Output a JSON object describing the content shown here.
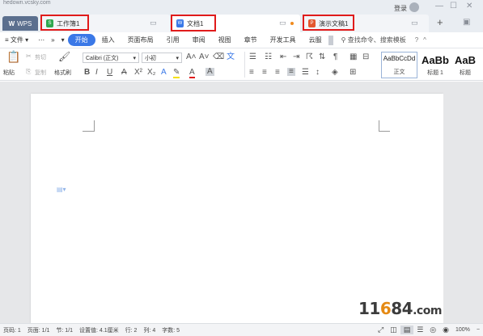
{
  "source_url_partial": "hedown.vcsky.com",
  "titlebar": {
    "wps_label": "WPS",
    "login_label": "登录",
    "tabs": [
      {
        "label": "工作簿1",
        "kind": "spreadsheet",
        "color": "#2fa84f",
        "outlined": true
      },
      {
        "label": "文档1",
        "kind": "document",
        "color": "#3a78e7",
        "outlined": true,
        "active": true
      },
      {
        "label": "演示文稿1",
        "kind": "presentation",
        "color": "#e4572e",
        "outlined": true
      }
    ],
    "new_tab_label": "+"
  },
  "menu": {
    "hamburger_label": "文件",
    "items": [
      "开始",
      "插入",
      "页面布局",
      "引用",
      "审阅",
      "视图",
      "章节",
      "开发工具",
      "云服"
    ],
    "active_item": "开始",
    "search_placeholder": "查找命令、搜索模板"
  },
  "ribbon": {
    "paste_label": "粘贴",
    "cut_label": "剪切",
    "copy_label": "复制",
    "format_painter_label": "格式刷",
    "font_name": "Calibri (正文)",
    "font_size": "小初",
    "styles": [
      {
        "preview": "AaBbCcDd",
        "label": "正文"
      },
      {
        "preview": "AaBb",
        "label": "标题 1"
      },
      {
        "preview": "AaB",
        "label": "标题"
      }
    ]
  },
  "statusbar": {
    "page_count": "页码: 1",
    "page": "页面: 1/1",
    "section": "节: 1/1",
    "setting": "设置值: 4.1厘米",
    "row": "行: 2",
    "col": "列: 4",
    "chars": "字数: 5",
    "zoom": "100%"
  },
  "watermark": {
    "pre": "11",
    "dot": "6",
    "post": "84",
    "suffix": ".com"
  },
  "colors": {
    "accent": "#3a78e7",
    "highlight_box": "#e01b1b"
  }
}
